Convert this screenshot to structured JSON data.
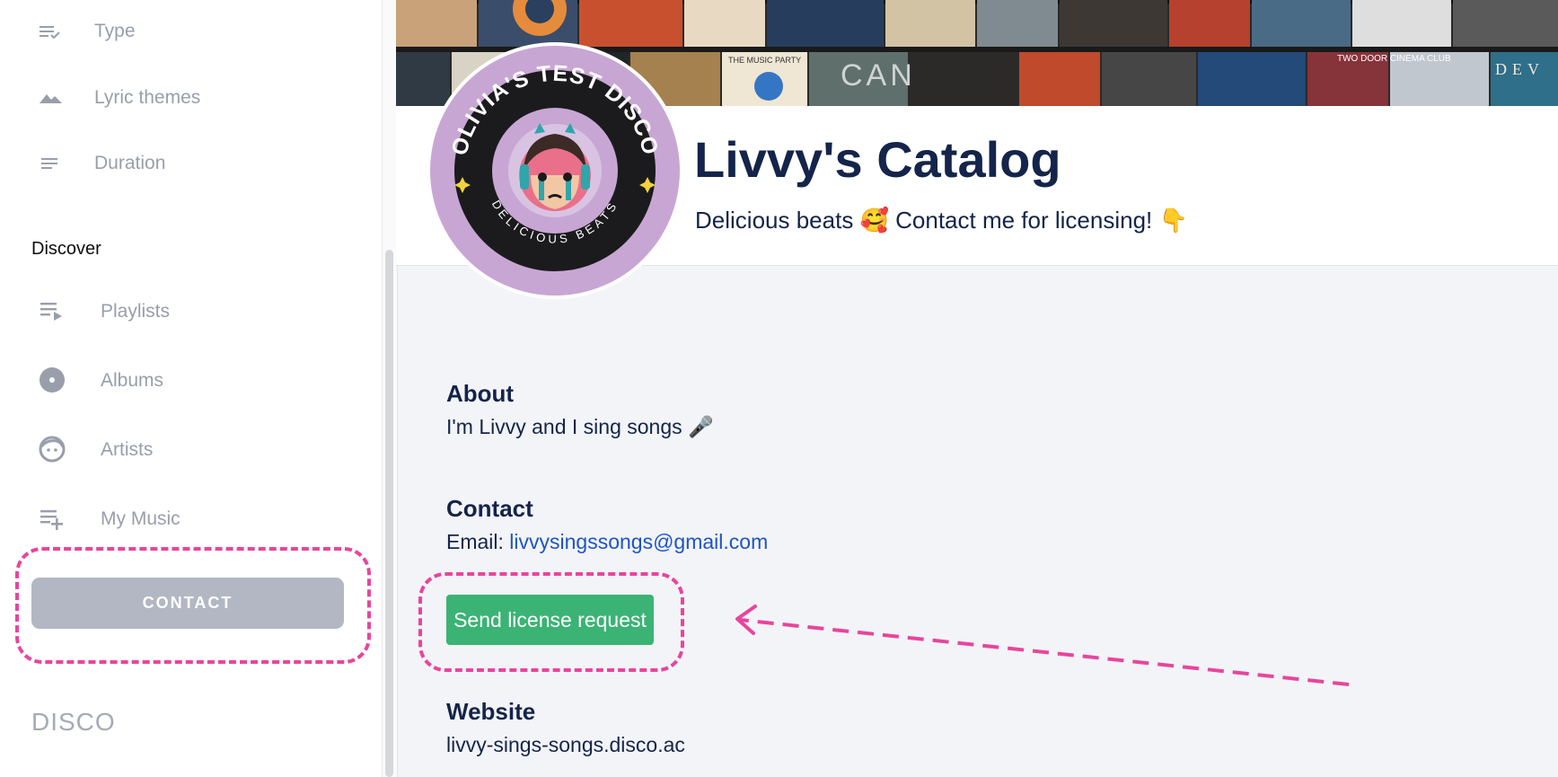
{
  "sidebar": {
    "filters": [
      {
        "label": "Type",
        "icon": "sort-check-icon"
      },
      {
        "label": "Lyric themes",
        "icon": "mountain-icon"
      },
      {
        "label": "Duration",
        "icon": "lines-icon"
      }
    ],
    "discover_heading": "Discover",
    "discover": [
      {
        "label": "Playlists",
        "icon": "playlist-play-icon"
      },
      {
        "label": "Albums",
        "icon": "disc-icon"
      },
      {
        "label": "Artists",
        "icon": "face-icon"
      },
      {
        "label": "My Music",
        "icon": "playlist-add-icon"
      }
    ],
    "contact_label": "CONTACT",
    "brand": "DISCO"
  },
  "header": {
    "avatar_text_top": "OLIVIA'S TEST DISCO",
    "avatar_text_bottom": "DELICIOUS BEATS",
    "title": "Livvy's Catalog",
    "tagline": "Delicious beats 🥰 Contact me for licensing! 👇",
    "banner_album_texts": [
      "THE MUSIC PARTY",
      "CAN",
      "TWO DOOR CINEMA CLUB",
      "DEV"
    ]
  },
  "profile": {
    "about_title": "About",
    "about_text": "I'm Livvy and I sing songs 🎤",
    "contact_title": "Contact",
    "email_label": "Email: ",
    "email": "livvysingssongs@gmail.com",
    "license_button": "Send license request",
    "website_title": "Website",
    "website": "livvy-sings-songs.disco.ac"
  },
  "colors": {
    "accent_green": "#3bb374",
    "annotation_pink": "#e8459d",
    "heading_navy": "#14244a",
    "link_blue": "#1d55c6",
    "avatar_purple": "#c8a6d4"
  }
}
